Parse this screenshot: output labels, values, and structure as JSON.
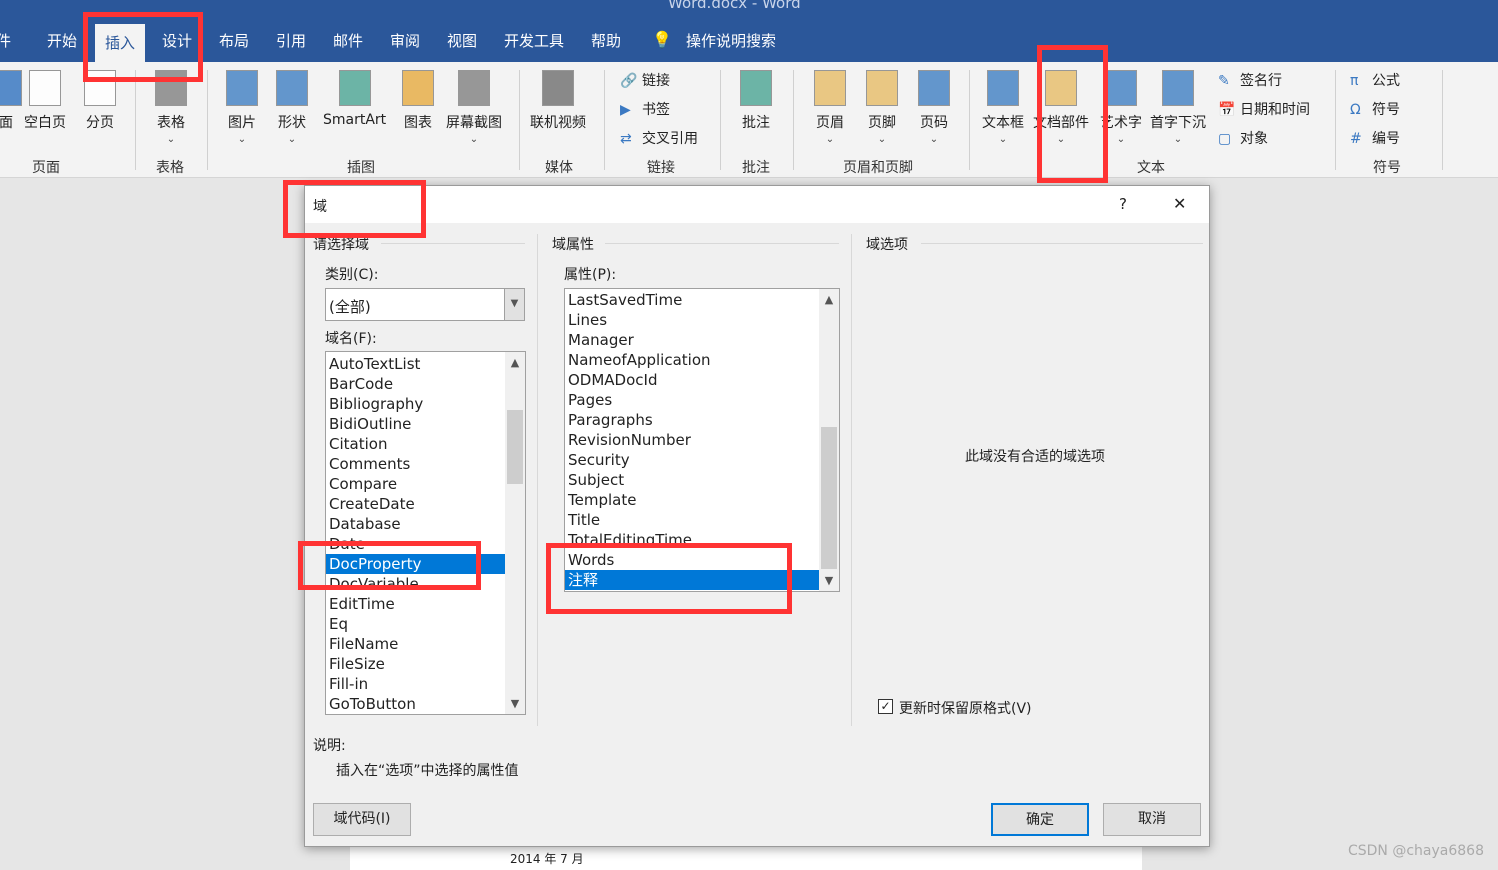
{
  "window": {
    "title": "Word.docx  -  Word"
  },
  "tabs": [
    {
      "label": "件"
    },
    {
      "label": "开始"
    },
    {
      "label": "插入",
      "active": true
    },
    {
      "label": "设计"
    },
    {
      "label": "布局"
    },
    {
      "label": "引用"
    },
    {
      "label": "邮件"
    },
    {
      "label": "审阅"
    },
    {
      "label": "视图"
    },
    {
      "label": "开发工具"
    },
    {
      "label": "帮助"
    }
  ],
  "tell_me": "操作说明搜索",
  "ribbon": {
    "groups": [
      "页面",
      "表格",
      "插图",
      "媒体",
      "链接",
      "批注",
      "页眉和页脚",
      "文本",
      "符号"
    ],
    "big_buttons": [
      "面",
      "空白页",
      "分页",
      "表格",
      "图片",
      "形状",
      "SmartArt",
      "图表",
      "屏幕截图",
      "联机视频",
      "批注",
      "页眉",
      "页脚",
      "页码",
      "文本框",
      "文档部件",
      "艺术字",
      "首字下沉"
    ],
    "small_buttons": [
      "链接",
      "书签",
      "交叉引用",
      "签名行",
      "日期和时间",
      "对象",
      "公式",
      "符号",
      "编号"
    ]
  },
  "dialog": {
    "title": "域",
    "help": "?",
    "close": "✕",
    "left_section": "请选择域",
    "category_label": "类别(C):",
    "category_value": "(全部)",
    "field_names_label": "域名(F):",
    "field_names": [
      "AutoTextList",
      "BarCode",
      "Bibliography",
      "BidiOutline",
      "Citation",
      "Comments",
      "Compare",
      "CreateDate",
      "Database",
      "Date",
      "DocProperty",
      "DocVariable",
      "EditTime",
      "Eq",
      "FileName",
      "FileSize",
      "Fill-in",
      "GoToButton"
    ],
    "field_selected": "DocProperty",
    "props_section": "域属性",
    "props_label": "属性(P):",
    "properties": [
      "LastSavedTime",
      "Lines",
      "Manager",
      "NameofApplication",
      "ODMADocId",
      "Pages",
      "Paragraphs",
      "RevisionNumber",
      "Security",
      "Subject",
      "Template",
      "Title",
      "TotalEditingTime",
      "Words",
      "注释"
    ],
    "property_selected": "注释",
    "options_section": "域选项",
    "no_options": "此域没有合适的域选项",
    "preserve_label": "更新时保留原格式(V)",
    "preserve_checked": true,
    "desc_label": "说明:",
    "desc_text": "插入在“选项”中选择的属性值",
    "field_codes_button": "域代码(I)",
    "ok_button": "确定",
    "cancel_button": "取消"
  },
  "document": {
    "text": "2014 年 7 月"
  },
  "watermark": "CSDN @chaya6868",
  "colors": {
    "title_bar": "#2b579a",
    "selection": "#0078d7",
    "highlight_box": "#ff3333"
  }
}
